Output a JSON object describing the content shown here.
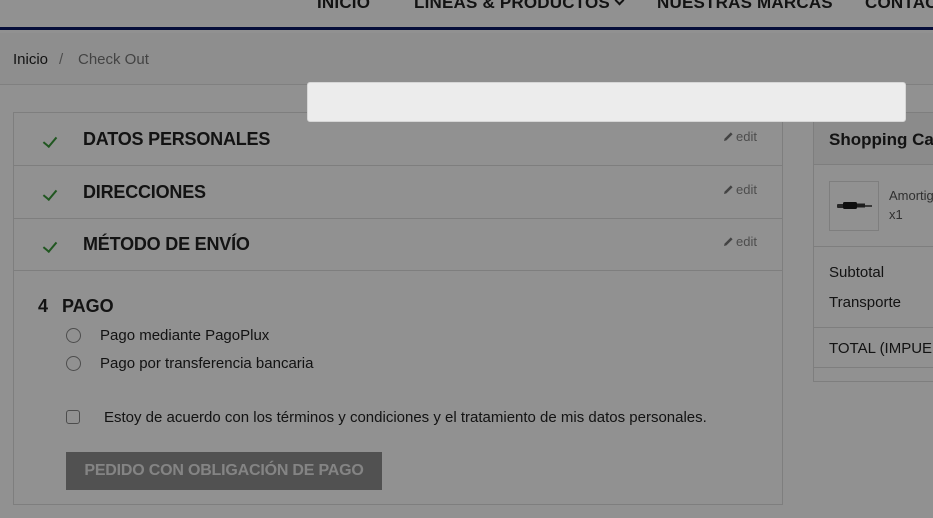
{
  "nav": {
    "items": [
      "INICIO",
      "LÍNEAS & PRODUCTOS",
      "NUESTRAS MARCAS",
      "CONTACTO"
    ]
  },
  "breadcrumb": {
    "home": "Inicio",
    "separator": "/",
    "current": "Check Out"
  },
  "checkout": {
    "steps": [
      {
        "title": "DATOS PERSONALES",
        "edit": "edit"
      },
      {
        "title": "DIRECCIONES",
        "edit": "edit"
      },
      {
        "title": "MÉTODO DE ENVÍO",
        "edit": "edit"
      }
    ],
    "payment": {
      "number": "4",
      "title": "PAGO",
      "options": [
        "Pago mediante PagoPlux",
        "Pago por transferencia bancaria"
      ],
      "terms": "Estoy de acuerdo con los términos y condiciones y el tratamiento de mis datos personales.",
      "submit": "PEDIDO CON OBLIGACIÓN DE PAGO"
    }
  },
  "cart": {
    "title": "Shopping Cart",
    "item": {
      "name": "Amortiguador",
      "qty": "x1"
    },
    "subtotal_label": "Subtotal",
    "shipping_label": "Transporte",
    "total_label": "TOTAL (IMPUESTOS INCL.)"
  },
  "colors": {
    "nav_underline": "#0c1a66",
    "check": "#3a9a3a",
    "overlay": "rgba(0,0,0,0.43)"
  },
  "icons": [
    "check-icon",
    "pencil-icon",
    "chevron-down-icon"
  ]
}
